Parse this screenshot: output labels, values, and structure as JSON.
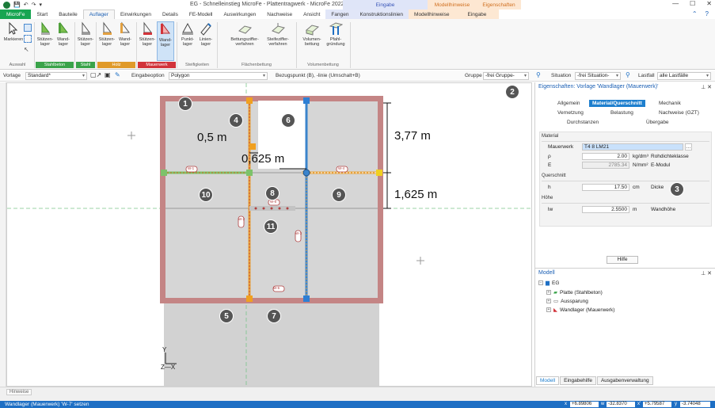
{
  "titlebar": {
    "title": "EG - Schnelleinstieg MicroFe - Plattentragwerk - MicroFe 2022",
    "ctx_headers": [
      {
        "label": "Eingabe",
        "bg": "#dfe5f8",
        "color": "#3a56b8"
      },
      {
        "label": "Modellhinweise",
        "bg": "#fde7d2",
        "color": "#d07020"
      },
      {
        "label": "Eigenschaften",
        "bg": "#fde7d2",
        "color": "#d07020"
      }
    ],
    "win": {
      "minimize": "—",
      "maximize": "☐",
      "close": "✕"
    }
  },
  "tabs": [
    "MicroFe",
    "Start",
    "Bauteile",
    "Auflager",
    "Einwirkungen",
    "Details",
    "FE-Modell",
    "Auswirkungen",
    "Nachweise",
    "Ansicht",
    "Fangen",
    "Konstruktionslinien",
    "Modellhinweise",
    "Eingabe"
  ],
  "ribbon": {
    "buttons": [
      {
        "label": "Markieren",
        "icon": "cursor-icon"
      },
      {
        "label": "Stützen-\nlager",
        "icon": "column-support-icon"
      },
      {
        "label": "Wand-\nlager",
        "icon": "wall-support-icon"
      },
      {
        "label": "Stützen-\nlager",
        "icon": "column-support-steel-icon"
      },
      {
        "label": "Stützen-\nlager",
        "icon": "column-support-wood-icon"
      },
      {
        "label": "Wand-\nlager",
        "icon": "wall-support-wood-icon"
      },
      {
        "label": "Stützen-\nlager",
        "icon": "column-support-masonry-icon"
      },
      {
        "label": "Wand-\nlager",
        "icon": "wall-support-masonry-icon"
      },
      {
        "label": "Punkt-\nlager",
        "icon": "point-support-icon"
      },
      {
        "label": "Linien-\nlager",
        "icon": "line-support-icon"
      },
      {
        "label": "Bettungsziffer-\nverfahren",
        "icon": "bedding-modulus-icon"
      },
      {
        "label": "Steifeziffer-\nverfahren",
        "icon": "stiffness-modulus-icon"
      },
      {
        "label": "Volumen-\nbettung",
        "icon": "volume-bedding-icon"
      },
      {
        "label": "Pfahl-\ngründung",
        "icon": "pile-foundation-icon"
      }
    ],
    "groups": [
      {
        "label": "Auswahl",
        "color": ""
      },
      {
        "label": "Stahlbeton",
        "color": "#3aa34a"
      },
      {
        "label": "Stahl",
        "color": "#3aa34a"
      },
      {
        "label": "Holz",
        "color": "#e09a2a"
      },
      {
        "label": "Mauerwerk",
        "color": "#d2333a"
      },
      {
        "label": "Steifigkeiten",
        "color": ""
      },
      {
        "label": "Flächenbettung",
        "color": ""
      },
      {
        "label": "Volumenbettung",
        "color": ""
      }
    ]
  },
  "toolbar": {
    "vorlage_label": "Vorlage",
    "vorlage_value": "Standard*",
    "eingabeoption_label": "Eingabeoption",
    "eingabeoption_value": "Polygon",
    "bezugspunkt_label": "Bezugspunkt (B), -linie (Umschalt+B)",
    "gruppe_label": "Gruppe",
    "gruppe_value": "-frei Gruppe-",
    "situation_label": "Situation",
    "situation_value": "-frei Situation-",
    "lastfall_label": "Lastfall",
    "lastfall_value": "alle Lastfälle"
  },
  "canvas": {
    "dims": {
      "d1": "0,5 m",
      "d2": "0,625 m",
      "d3": "3,77 m",
      "d4": "1,625 m"
    },
    "wall_labels": [
      "W-1",
      "W-4",
      "W-6",
      "W-2",
      "W-3",
      "W-5",
      "W-7"
    ],
    "axis": {
      "y": "Y",
      "zx": "Z—X"
    },
    "callouts": [
      "1",
      "2",
      "3",
      "4",
      "5",
      "6",
      "7",
      "8",
      "9",
      "10",
      "11"
    ]
  },
  "props": {
    "title": "Eigenschaften: Vorlage 'Wandlager (Mauerwerk)'",
    "tabs": [
      "Allgemein",
      "Material/Querschnitt",
      "Mechanik",
      "Vernetzung",
      "Belastung",
      "Nachweise (GZT)",
      "Durchstanzen",
      "Übergabe"
    ],
    "material": {
      "section": "Material",
      "mauerwerk_label": "Mauerwerk",
      "mauerwerk_value": "T4 8 LM21",
      "rho_label": "ρ",
      "rho_value": "2.00",
      "rho_unit": "kg/dm³",
      "rho_desc": "Rohdichteklasse",
      "e_label": "E",
      "e_value": "2785.34",
      "e_unit": "N/mm²",
      "e_desc": "E-Modul"
    },
    "querschnitt": {
      "section": "Querschnitt",
      "h_label": "h",
      "h_value": "17.50",
      "h_unit": "cm",
      "h_desc": "Dicke"
    },
    "hoehe": {
      "section": "Höhe",
      "lw_label": "lw",
      "lw_value": "2.5500",
      "lw_unit": "m",
      "lw_desc": "Wandhöhe"
    },
    "hilfe": "Hilfe"
  },
  "model": {
    "title": "Modell",
    "root": "EG",
    "items": [
      "Platte (Stahlbeton)",
      "Aussparung",
      "Wandlager (Mauerwerk)"
    ],
    "bottom_tabs": [
      "Modell",
      "Eingabehilfe",
      "Ausgabenverwaltung"
    ]
  },
  "hinweise": "Hinweise",
  "status": {
    "text": "Wandlager (Mauerwerk) 'W-7' setzen",
    "coords": [
      {
        "label": "x",
        "value": "+6.89806"
      },
      {
        "label": "w",
        "value": "-32.8370"
      },
      {
        "label": "x'",
        "value": "+5.79587"
      },
      {
        "label": "y",
        "value": "-3.74048"
      }
    ]
  }
}
